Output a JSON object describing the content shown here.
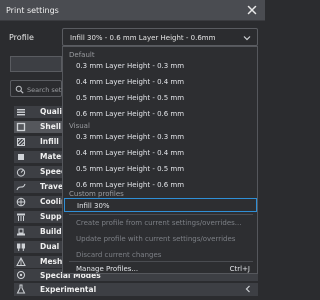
{
  "window": {
    "title": "Print settings"
  },
  "profile": {
    "label": "Profile",
    "selected": "Infill 30% - 0.6 mm Layer Height - 0.6mm"
  },
  "search": {
    "placeholder": "Search setti"
  },
  "categories": [
    {
      "label": "Quality",
      "icon": "quality-icon"
    },
    {
      "label": "Shell",
      "icon": "shell-icon"
    },
    {
      "label": "Infill",
      "icon": "infill-icon"
    },
    {
      "label": "Mater",
      "icon": "material-icon"
    },
    {
      "label": "Speed",
      "icon": "speed-icon"
    },
    {
      "label": "Travel",
      "icon": "travel-icon"
    },
    {
      "label": "Coolin",
      "icon": "cooling-icon"
    },
    {
      "label": "Suppo",
      "icon": "support-icon"
    },
    {
      "label": "Build",
      "icon": "build-plate-icon"
    },
    {
      "label": "Dual E",
      "icon": "dual-extrusion-icon"
    },
    {
      "label": "Mesh",
      "icon": "mesh-icon"
    },
    {
      "label": "Special Modes",
      "icon": "special-modes-icon"
    },
    {
      "label": "Experimental",
      "icon": "experimental-icon"
    }
  ],
  "dropdown": {
    "default_header": "Default",
    "default_items": [
      "0.3 mm Layer Height - 0.3 mm",
      "0.4 mm Layer Height - 0.4 mm",
      "0.5 mm Layer Height - 0.5 mm",
      "0.6 mm Layer Height - 0.6 mm"
    ],
    "visual_header": "Visual",
    "visual_items": [
      "0.3 mm Layer Height - 0.3 mm",
      "0.4 mm Layer Height - 0.4 mm",
      "0.5 mm Layer Height - 0.5 mm",
      "0.6 mm Layer Height - 0.6 mm"
    ],
    "custom_header": "Custom profiles",
    "custom_items": [
      "Infill 30%"
    ],
    "actions": [
      "Create profile from current settings/overrides...",
      "Update profile with current settings/overrides",
      "Discard current changes"
    ],
    "manage_label": "Manage Profiles...",
    "manage_shortcut": "Ctrl+J"
  },
  "colors": {
    "accent": "#2f8fd6",
    "background": "#2b2c2f",
    "titlebar": "#4a4c51"
  }
}
